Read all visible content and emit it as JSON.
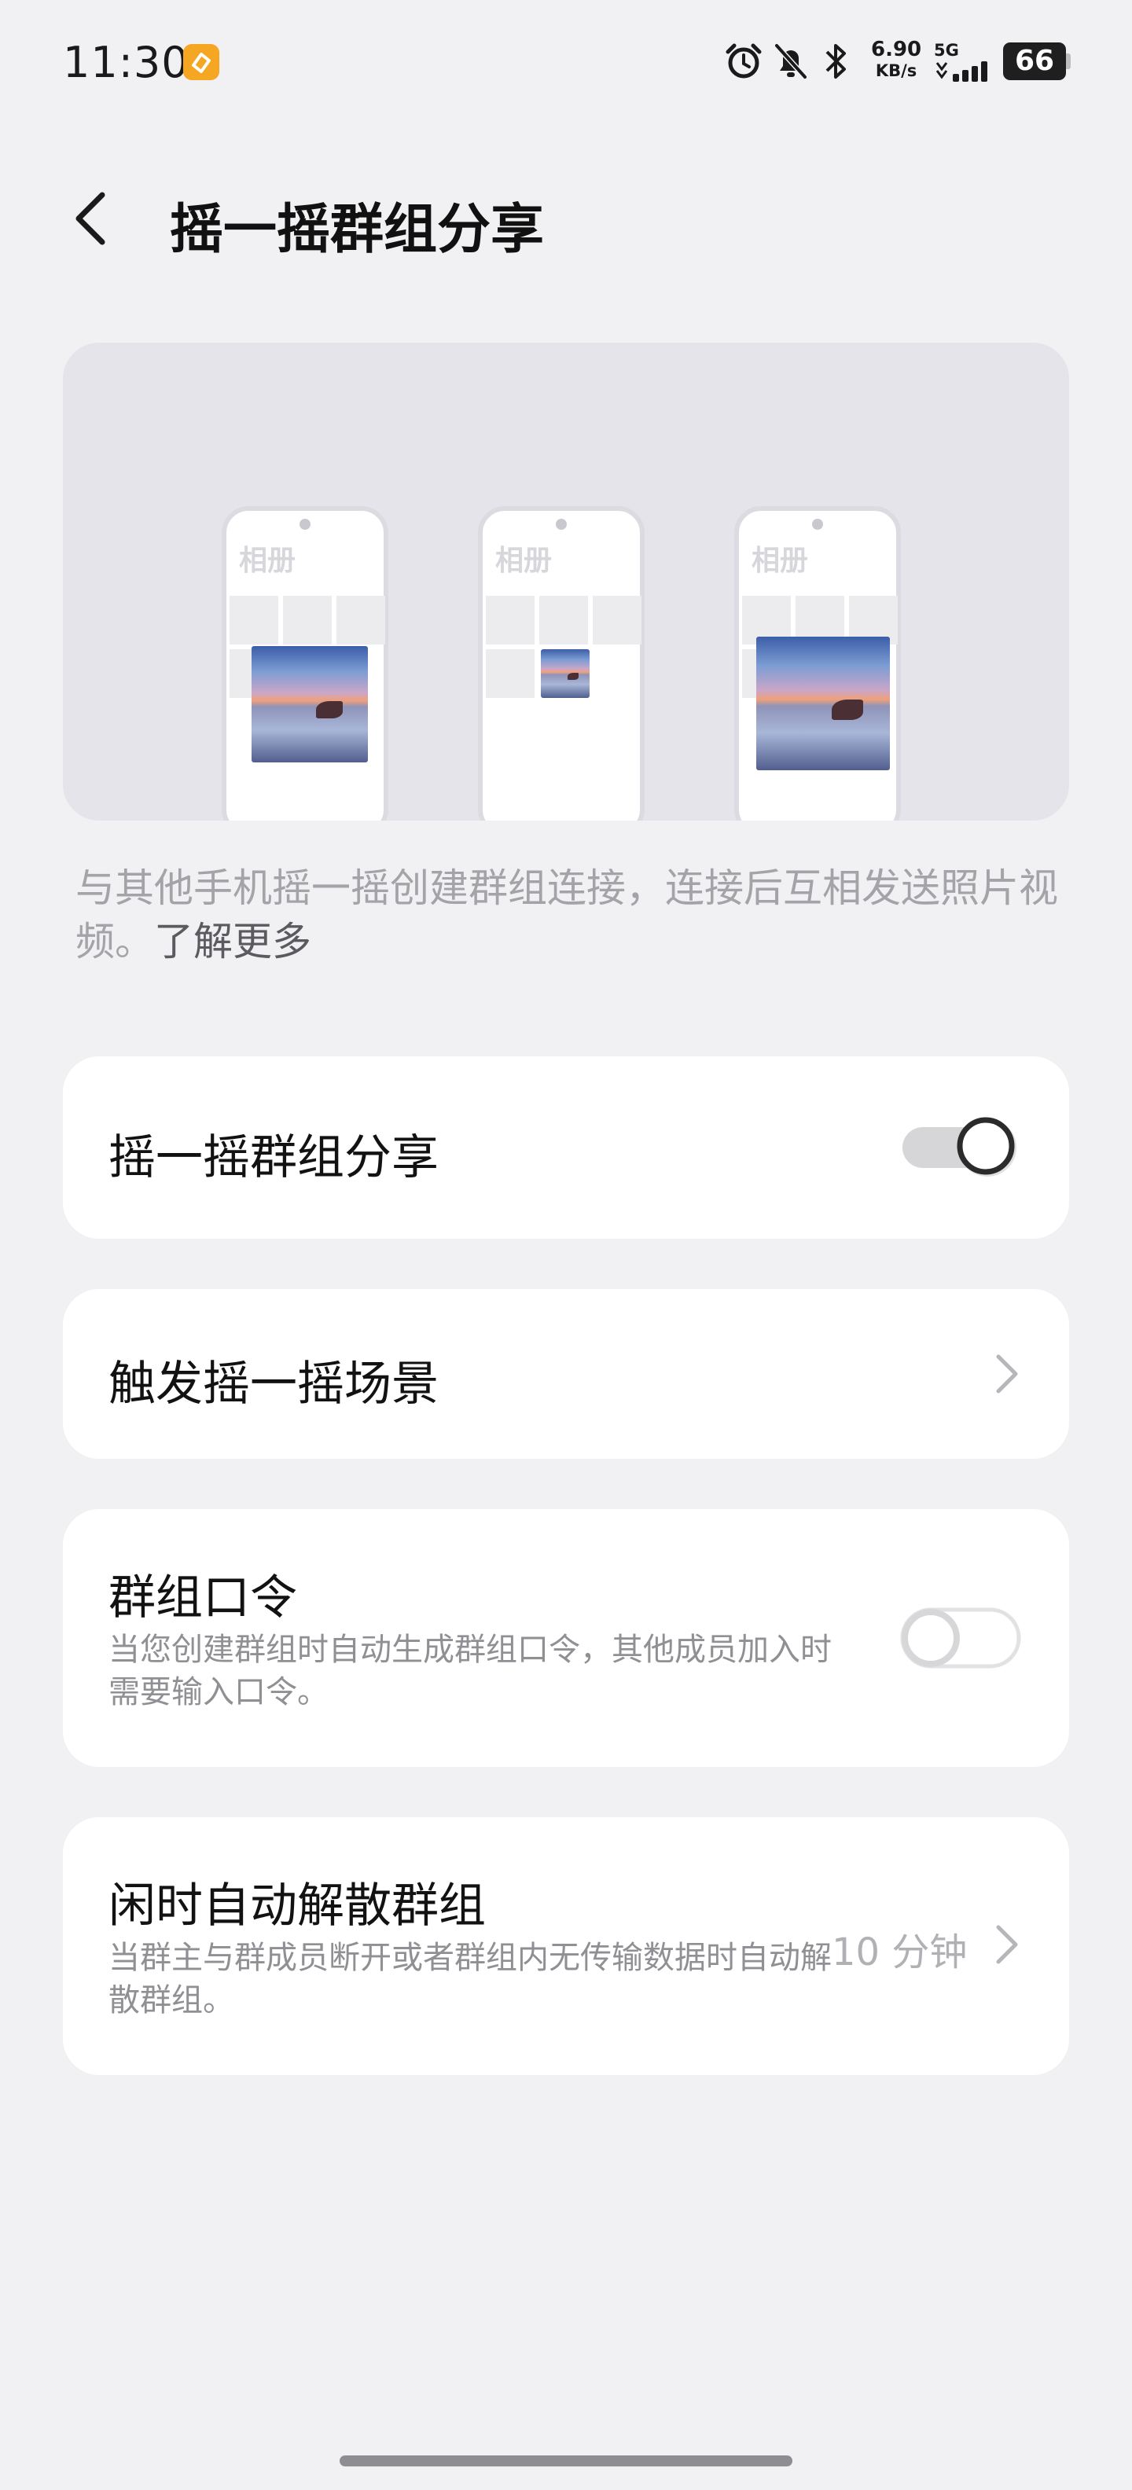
{
  "status_bar": {
    "time": "11:30",
    "net_speed_value": "6.90",
    "net_speed_unit": "KB/s",
    "network_type": "5G",
    "battery": "66",
    "icons": [
      "app-badge-icon",
      "alarm-icon",
      "bell-muted-icon",
      "bluetooth-icon",
      "signal-icon",
      "battery-icon"
    ]
  },
  "header": {
    "title": "摇一摇群组分享"
  },
  "illustration": {
    "album_label": "相册"
  },
  "description": {
    "text": "与其他手机摇一摇创建群组连接，连接后互相发送照片视频。",
    "link": "了解更多"
  },
  "settings": {
    "shake_share": {
      "title": "摇一摇群组分享",
      "enabled": true
    },
    "trigger_scene": {
      "title": "触发摇一摇场景"
    },
    "group_password": {
      "title": "群组口令",
      "subtitle": "当您创建群组时自动生成群组口令，其他成员加入时需要输入口令。",
      "enabled": false
    },
    "auto_dissolve": {
      "title": "闲时自动解散群组",
      "subtitle": "当群主与群成员断开或者群组内无传输数据时自动解散群组。",
      "value": "10 分钟"
    }
  },
  "colors": {
    "background": "#f1f1f3",
    "card": "#ffffff",
    "toggle_on_track": "#d6d6d9",
    "toggle_knob_border": "#2b2b2b",
    "secondary_text": "#8f8f94"
  }
}
